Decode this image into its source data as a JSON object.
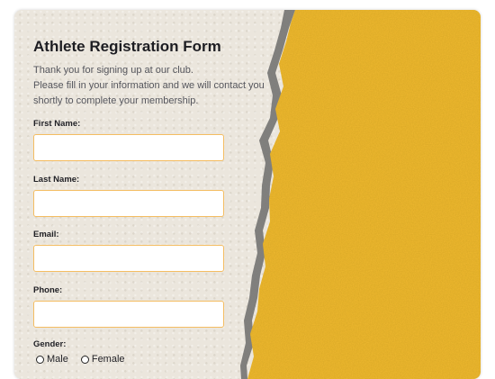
{
  "form": {
    "title": "Athlete Registration Form",
    "intro": [
      "Thank you for signing up at our club.",
      "Please fill in your information and we will contact you",
      "shortly to complete your membership."
    ],
    "fields": [
      {
        "label": "First Name:",
        "value": "",
        "placeholder": ""
      },
      {
        "label": "Last Name:",
        "value": "",
        "placeholder": ""
      },
      {
        "label": "Email:",
        "value": "",
        "placeholder": ""
      },
      {
        "label": "Phone:",
        "value": "",
        "placeholder": ""
      }
    ],
    "gender": {
      "label": "Gender:",
      "options": [
        "Male",
        "Female"
      ]
    }
  },
  "colors": {
    "paper": "#ebe6dd",
    "accent_yellow": "#f0b933",
    "input_border": "#f4bd62",
    "title_text": "#1d1d22",
    "body_text": "#55565d"
  }
}
